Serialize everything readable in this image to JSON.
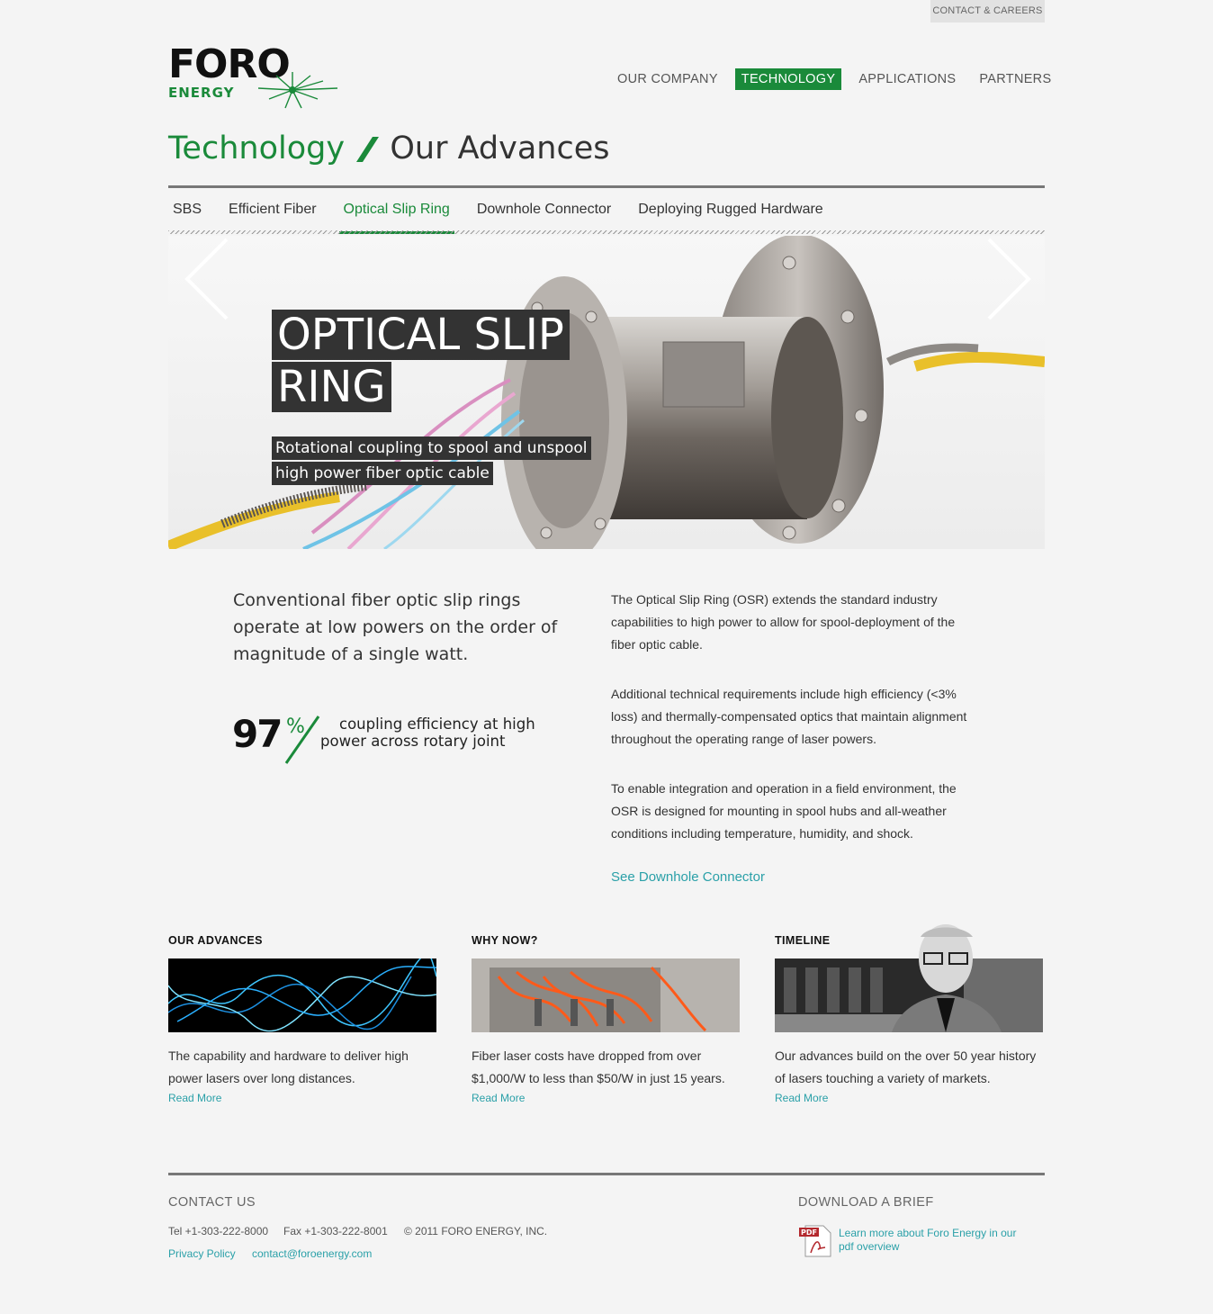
{
  "topbar": {
    "contact_careers": "CONTACT & CAREERS"
  },
  "logo": {
    "foro": "FORO",
    "energy": "ENERGY"
  },
  "nav": {
    "items": [
      "OUR COMPANY",
      "TECHNOLOGY",
      "APPLICATIONS",
      "PARTNERS"
    ],
    "active": "TECHNOLOGY"
  },
  "page": {
    "section": "Technology",
    "title": "Our Advances"
  },
  "subnav": {
    "items": [
      "SBS",
      "Efficient Fiber",
      "Optical Slip Ring",
      "Downhole Connector",
      "Deploying Rugged Hardware"
    ],
    "active": "Optical Slip Ring"
  },
  "hero": {
    "title_line1": "OPTICAL SLIP",
    "title_line2": "RING",
    "subtitle_line1": "Rotational coupling to spool and unspool",
    "subtitle_line2": "high power fiber optic cable"
  },
  "content": {
    "lead": "Conventional fiber optic slip rings operate at low powers on the order of magnitude of a single watt.",
    "stat_value": "97",
    "stat_unit": "%",
    "stat_desc_line1": "coupling efficiency at high",
    "stat_desc_line2": "power across rotary joint",
    "paragraphs": [
      "The Optical Slip Ring (OSR) extends the standard industry capabilities to high power to allow for spool-deployment of the fiber optic cable.",
      "Additional technical requirements include high efficiency (<3% loss) and thermally-compensated optics that maintain alignment throughout the operating range of laser powers.",
      "To enable integration and operation in a field environment, the OSR is designed for mounting in spool hubs and all-weather conditions including temperature, humidity, and shock."
    ],
    "see_link": "See Downhole Connector"
  },
  "columns": [
    {
      "heading": "OUR ADVANCES",
      "text": "The capability and hardware to deliver high power lasers over long distances.",
      "link": "Read More"
    },
    {
      "heading": "WHY NOW?",
      "text": "Fiber laser costs have dropped from over $1,000/W to less than $50/W in just 15 years.",
      "link": "Read More"
    },
    {
      "heading": "TIMELINE",
      "text": "Our advances build on the over 50 year history of lasers touching a variety of markets.",
      "link": "Read More"
    }
  ],
  "footer": {
    "contact_heading": "CONTACT US",
    "tel": "Tel +1-303-222-8000",
    "fax": "Fax +1-303-222-8001",
    "copyright": "© 2011 FORO ENERGY, INC.",
    "privacy": "Privacy Policy",
    "email": "contact@foroenergy.com",
    "brief_heading": "DOWNLOAD A BRIEF",
    "brief_link": "Learn more about Foro Energy in our pdf overview"
  },
  "colors": {
    "brand_green": "#1a8a3a",
    "link_teal": "#2aa0a8",
    "rule_gray": "#777777"
  },
  "icons": [
    "prev-arrow-icon",
    "next-arrow-icon",
    "pdf-icon"
  ]
}
